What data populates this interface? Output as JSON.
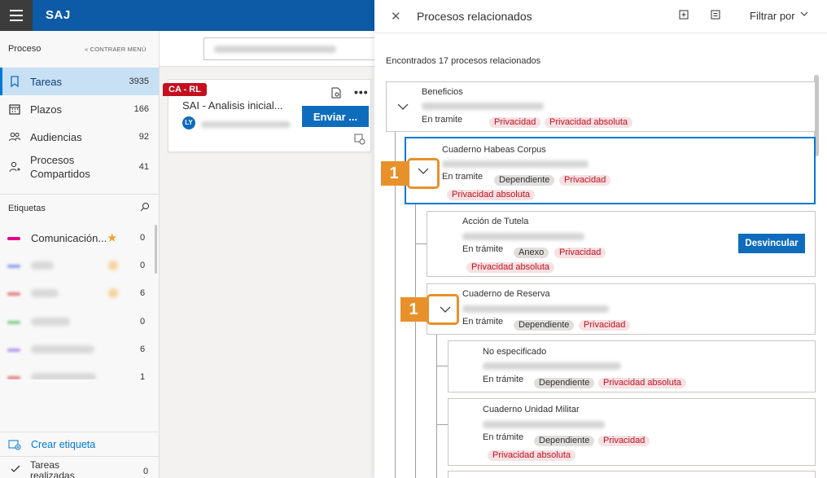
{
  "app": {
    "brand": "SAJ"
  },
  "sidebar": {
    "section_title": "Proceso",
    "collapse_label": "« CONTRAER MENÚ",
    "items": [
      {
        "label": "Tareas",
        "count": "3935",
        "icon": "bookmark-icon",
        "active": true
      },
      {
        "label": "Plazos",
        "count": "166",
        "icon": "calendar-icon"
      },
      {
        "label": "Audiencias",
        "count": "92",
        "icon": "people-icon"
      },
      {
        "label": "Procesos Compartidos",
        "count": "41",
        "icon": "person-share-icon"
      }
    ],
    "tags_title": "Etiquetas",
    "tags": [
      {
        "label": "Comunicación...",
        "count": "0",
        "color": "#e3008c",
        "starred": true
      },
      {
        "label": "",
        "count": "0",
        "color": "#8a9fe8",
        "starred": true
      },
      {
        "label": "",
        "count": "6",
        "color": "#e47b7b",
        "starred": true
      },
      {
        "label": "",
        "count": "0",
        "color": "#7fcf8a",
        "starred": false
      },
      {
        "label": "",
        "count": "6",
        "color": "#b197e8",
        "starred": false
      },
      {
        "label": "",
        "count": "1",
        "color": "#e47b7b",
        "starred": false
      }
    ],
    "create_tag": "Crear etiqueta",
    "done_tasks": "Tareas realizadas",
    "done_count": "0"
  },
  "task_card": {
    "badge": "CA - RL",
    "title": "SAI - Analisis inicial...",
    "avatar": "LY",
    "action": "Enviar ..."
  },
  "panel": {
    "title": "Procesos relacionados",
    "filter_label": "Filtrar por",
    "found_text": "Encontrados 17 procesos relacionados",
    "nodes": [
      {
        "title": "Beneficios",
        "status": "En tramite",
        "tags": [
          "Privacidad",
          "Privacidad absoluta"
        ]
      },
      {
        "title": "Cuaderno Habeas Corpus",
        "status": "En tramite",
        "tags": [
          "Dependiente",
          "Privacidad",
          "Privacidad absoluta"
        ]
      },
      {
        "title": "Acción de Tutela",
        "status": "En trámite",
        "tags": [
          "Anexo",
          "Privacidad",
          "Privacidad absoluta"
        ],
        "action": "Desvincular"
      },
      {
        "title": "Cuaderno de Reserva",
        "status": "En trámite",
        "tags": [
          "Dependiente",
          "Privacidad"
        ]
      },
      {
        "title": "No especificado",
        "status": "En trámite",
        "tags": [
          "Dependiente",
          "Privacidad absoluta"
        ]
      },
      {
        "title": "Cuaderno Unidad Militar",
        "status": "En trámite",
        "tags": [
          "Dependiente",
          "Privacidad",
          "Privacidad absoluta"
        ]
      }
    ]
  },
  "callouts": [
    "1",
    "1"
  ],
  "colors": {
    "brand_blue": "#0d5aa7",
    "accent": "#0078d4",
    "callout": "#e8912b",
    "tag_red": "#c50f1f"
  }
}
